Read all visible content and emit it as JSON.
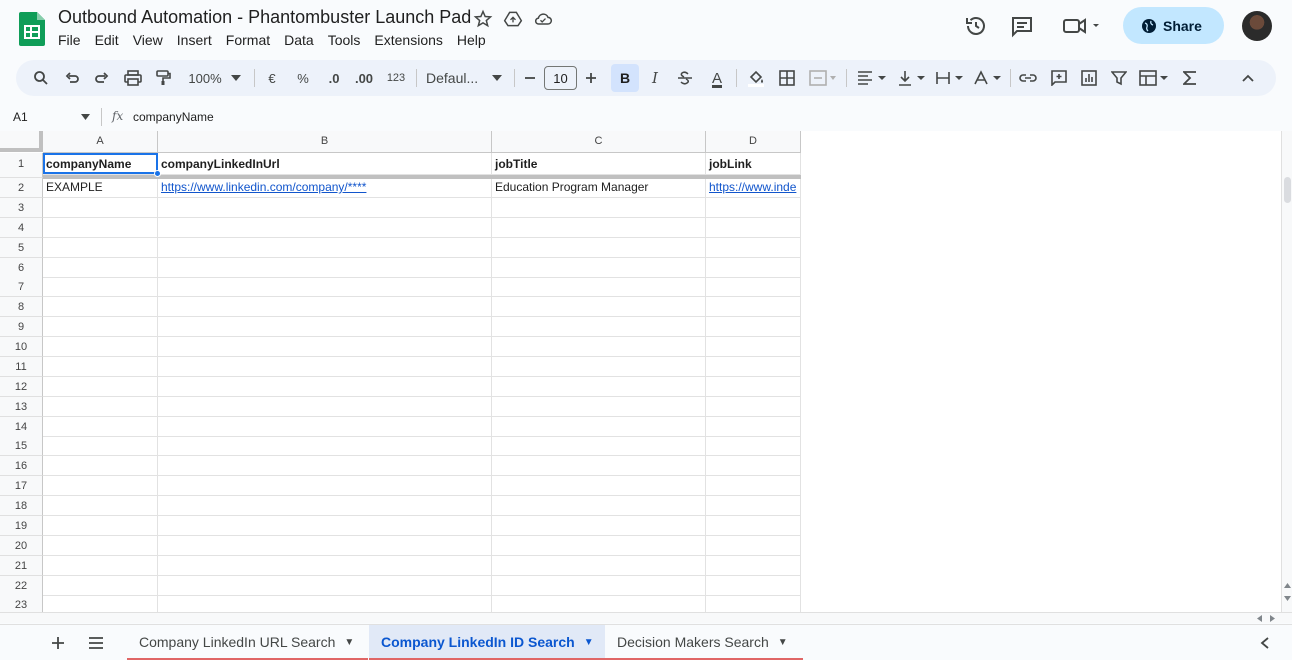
{
  "app": {
    "title": "Outbound Automation - Phantombuster Launch Pad",
    "menu": [
      "File",
      "Edit",
      "View",
      "Insert",
      "Format",
      "Data",
      "Tools",
      "Extensions",
      "Help"
    ],
    "share_label": "Share"
  },
  "toolbar": {
    "zoom": "100%",
    "currency": "€",
    "percent": "%",
    "dec_decrease": ".0",
    "dec_increase": ".00",
    "number_format": "123",
    "font": "Defaul...",
    "font_size": "10",
    "bold": "B",
    "italic": "I",
    "text_color_letter": "A"
  },
  "formula_bar": {
    "cell_ref": "A1",
    "fx": "fx",
    "content": "companyName"
  },
  "grid": {
    "columns": [
      "A",
      "B",
      "C",
      "D"
    ],
    "headers": [
      "companyName",
      "companyLinkedInUrl",
      "jobTitle",
      "jobLink"
    ],
    "row2": [
      "EXAMPLE",
      "https://www.linkedin.com/company/****",
      "Education Program Manager",
      "https://www.inde"
    ],
    "row_numbers": [
      "1",
      "2",
      "3",
      "4",
      "5",
      "6",
      "7",
      "8",
      "9",
      "10",
      "11",
      "12",
      "13",
      "14",
      "15",
      "16",
      "17",
      "18",
      "19",
      "20",
      "21",
      "22",
      "23"
    ]
  },
  "sheets": [
    {
      "label": "Company LinkedIn URL Search",
      "active": false
    },
    {
      "label": "Company LinkedIn ID Search",
      "active": true
    },
    {
      "label": "Decision Makers Search",
      "active": false
    }
  ],
  "colors": {
    "accent": "#1a73e8",
    "share_bg": "#c2e7ff",
    "link": "#1155cc",
    "active_tab": "#0b57d0"
  }
}
